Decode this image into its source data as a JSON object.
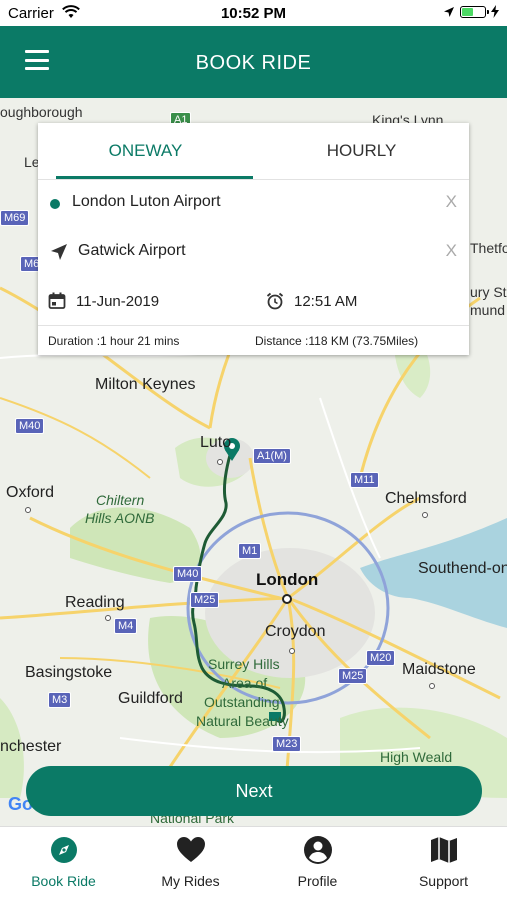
{
  "status_bar": {
    "carrier": "Carrier",
    "time": "10:52 PM"
  },
  "header": {
    "title": "BOOK RIDE"
  },
  "booking": {
    "tabs": [
      {
        "label": "ONEWAY",
        "active": true
      },
      {
        "label": "HOURLY",
        "active": false
      }
    ],
    "pickup": "London Luton Airport",
    "dropoff": "Gatwick Airport",
    "clear_label": "X",
    "date": "11-Jun-2019",
    "time": "12:51 AM",
    "duration": "Duration :1 hour 21 mins",
    "distance": "Distance :118 KM (73.75Miles)"
  },
  "map_labels": {
    "loughborough": "oughborough",
    "kings_lynn": "King's Lynn",
    "le": "Le",
    "thetford": "Thetfor",
    "bury": "ury St",
    "edmunds": "mund",
    "milton_keynes": "Milton Keynes",
    "luton": "Luto",
    "oxford": "Oxford",
    "chelmsford": "Chelmsford",
    "chiltern1": "Chiltern",
    "chiltern2": "Hills AONB",
    "london": "London",
    "southend": "Southend-on",
    "reading": "Reading",
    "croydon": "Croydon",
    "basingstoke": "Basingstoke",
    "maidstone": "Maidstone",
    "guildford": "Guildford",
    "surrey1": "Surrey Hills",
    "surrey2": "Area of",
    "surrey3": "Outstanding",
    "surrey4": "Natural Beauty",
    "chester": "nchester",
    "high_weald": "High Weald",
    "national_park": "National Park",
    "google": "Go"
  },
  "road_shields": {
    "a1": "A1",
    "m69": "M69",
    "m6": "M6",
    "m40a": "M40",
    "a1m": "A1(M)",
    "m11": "M11",
    "m1": "M1",
    "m40b": "M40",
    "m25a": "M25",
    "m4": "M4",
    "m20": "M20",
    "m25b": "M25",
    "m3": "M3",
    "m23": "M23"
  },
  "next_button": "Next",
  "tab_bar": [
    {
      "label": "Book Ride",
      "icon": "compass-icon",
      "active": true
    },
    {
      "label": "My Rides",
      "icon": "heart-icon",
      "active": false
    },
    {
      "label": "Profile",
      "icon": "person-icon",
      "active": false
    },
    {
      "label": "Support",
      "icon": "map-icon",
      "active": false
    }
  ],
  "colors": {
    "brand": "#0b7a66",
    "route": "#1e5b35",
    "shield": "#5964b8"
  }
}
